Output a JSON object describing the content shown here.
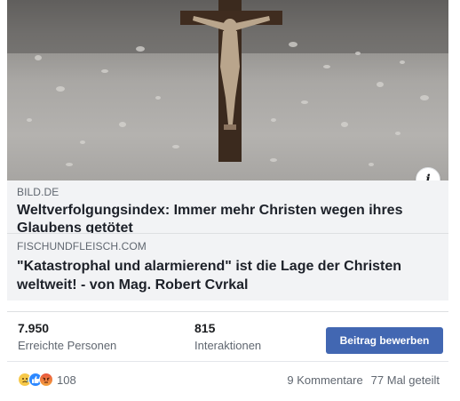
{
  "preview_primary": {
    "domain": "BILD.DE",
    "title": "Weltverfolgungsindex: Immer mehr Christen wegen ihres Glaubens getötet"
  },
  "preview_secondary": {
    "domain": "FISCHUNDFLEISCH.COM",
    "title": "\"Katastrophal und alarmierend\" ist die Lage der Christen weltweit! - von Mag. Robert Cvrkal"
  },
  "info_button": {
    "label": "i",
    "icon": "info-icon"
  },
  "stats": {
    "reach": {
      "value": "7.950",
      "label": "Erreichte Personen"
    },
    "engagement": {
      "value": "815",
      "label": "Interaktionen"
    }
  },
  "boost_button": {
    "label": "Beitrag bewerben",
    "color": "#4267b2"
  },
  "reactions": {
    "icons": [
      "sad-icon",
      "like-icon",
      "angry-icon"
    ],
    "count": "108"
  },
  "footer": {
    "comments": "9 Kommentare",
    "shares": "77 Mal geteilt"
  }
}
